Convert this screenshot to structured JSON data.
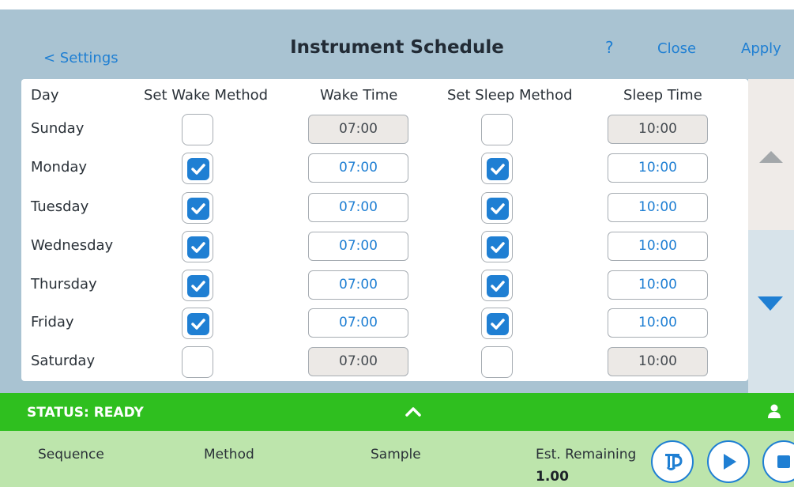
{
  "header": {
    "back_label": "< Settings",
    "title": "Instrument Schedule",
    "help_label": "?",
    "close_label": "Close",
    "apply_label": "Apply"
  },
  "table": {
    "columns": [
      "Day",
      "Set Wake Method",
      "Wake Time",
      "Set Sleep Method",
      "Sleep Time"
    ],
    "rows": [
      {
        "day": "Sunday",
        "wake_enabled": false,
        "wake_time": "07:00",
        "sleep_enabled": false,
        "sleep_time": "10:00"
      },
      {
        "day": "Monday",
        "wake_enabled": true,
        "wake_time": "07:00",
        "sleep_enabled": true,
        "sleep_time": "10:00"
      },
      {
        "day": "Tuesday",
        "wake_enabled": true,
        "wake_time": "07:00",
        "sleep_enabled": true,
        "sleep_time": "10:00"
      },
      {
        "day": "Wednesday",
        "wake_enabled": true,
        "wake_time": "07:00",
        "sleep_enabled": true,
        "sleep_time": "10:00"
      },
      {
        "day": "Thursday",
        "wake_enabled": true,
        "wake_time": "07:00",
        "sleep_enabled": true,
        "sleep_time": "10:00"
      },
      {
        "day": "Friday",
        "wake_enabled": true,
        "wake_time": "07:00",
        "sleep_enabled": true,
        "sleep_time": "10:00"
      },
      {
        "day": "Saturday",
        "wake_enabled": false,
        "wake_time": "07:00",
        "sleep_enabled": false,
        "sleep_time": "10:00"
      }
    ]
  },
  "scroll": {
    "up_icon": "triangle-up-icon",
    "down_icon": "triangle-down-icon"
  },
  "status": {
    "text": "STATUS: READY",
    "expand_icon": "chevron-up-icon",
    "user_icon": "person-icon"
  },
  "bottom": {
    "sequence_label": "Sequence",
    "method_label": "Method",
    "sample_label": "Sample",
    "remaining_label": "Est. Remaining",
    "remaining_value": "1.00",
    "buttons": [
      "pump-icon",
      "play-icon",
      "stop-icon"
    ]
  },
  "colors": {
    "accent": "#1f7fd3",
    "header_bg": "#a9c3d2",
    "status_green": "#2fbf1f",
    "bottom_green": "#bde5ac"
  }
}
